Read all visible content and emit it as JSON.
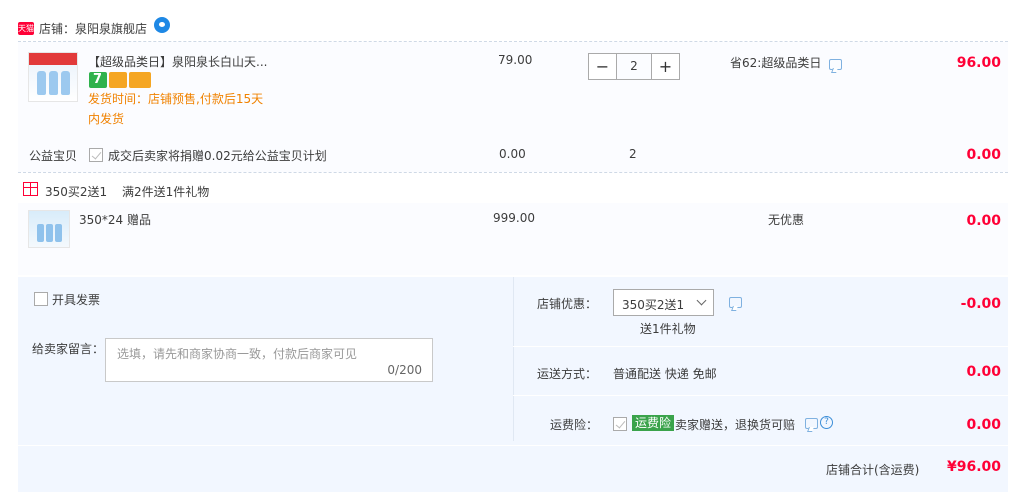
{
  "shop": {
    "tag": "天猫",
    "label": "店铺：泉阳泉旗舰店"
  },
  "item1": {
    "title": "【超级品类日】泉阳泉长白山天...",
    "delivery_line1": "发货时间：店铺预售,付款后15天",
    "delivery_line2": "内发货",
    "unit_price": "79.00",
    "quantity": "2",
    "minus": "−",
    "plus": "+",
    "discount": "省62:超级品类日",
    "subtotal": "96.00"
  },
  "charity": {
    "label": "公益宝贝",
    "desc": "成交后卖家将捐赠0.02元给公益宝贝计划",
    "price": "0.00",
    "qty": "2",
    "subtotal": "0.00"
  },
  "promo": {
    "name": "350买2送1",
    "desc": "满2件送1件礼物"
  },
  "gift": {
    "title": "350*24 赠品",
    "price": "999.00",
    "discount": "无优惠",
    "subtotal": "0.00"
  },
  "invoice": {
    "label": "开具发票"
  },
  "message": {
    "label": "给卖家留言：",
    "placeholder": "选填，请先和商家协商一致，付款后商家可见",
    "count": "0/200"
  },
  "shop_discount": {
    "label": "店铺优惠：",
    "selected": "350买2送1",
    "sub": "送1件礼物",
    "amount": "-0.00"
  },
  "shipping": {
    "label": "运送方式：",
    "value": "普通配送 快递 免邮",
    "amount": "0.00"
  },
  "insurance": {
    "label": "运费险：",
    "badge": "运费险",
    "desc": "卖家赠送，退换货可赔",
    "help": "?",
    "amount": "0.00"
  },
  "total": {
    "label": "店铺合计(含运费)",
    "amount": "¥96.00"
  },
  "colors": {
    "accent": "#ff0036",
    "orange": "#f08200",
    "green": "#3aa34b",
    "panel": "#f2f7ff"
  }
}
